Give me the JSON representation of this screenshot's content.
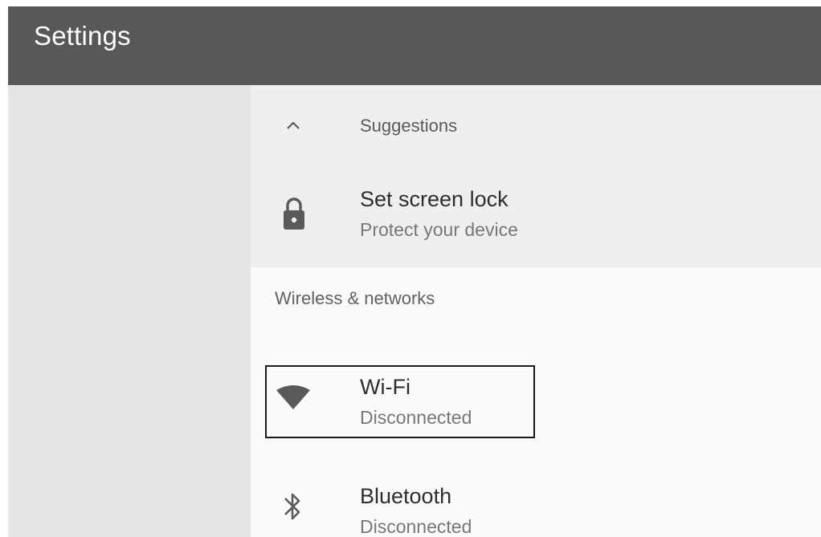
{
  "app_bar": {
    "title": "Settings"
  },
  "suggestions": {
    "label": "Suggestions",
    "toggle_icon": "chevron-up-icon",
    "items": [
      {
        "icon": "lock-icon",
        "title": "Set screen lock",
        "subtitle": "Protect your device"
      }
    ]
  },
  "wireless_networks": {
    "header": "Wireless & networks",
    "items": [
      {
        "icon": "wifi-icon",
        "title": "Wi-Fi",
        "subtitle": "Disconnected",
        "highlighted": true
      },
      {
        "icon": "bluetooth-icon",
        "title": "Bluetooth",
        "subtitle": "Disconnected"
      }
    ]
  },
  "colors": {
    "app_bar": "#585858",
    "left_pane": "#e5e5e5",
    "suggestions_bg": "#efefef",
    "content_bg": "#fafafa",
    "icon": "#5a5a5a",
    "highlight_border": "#1a1a1a"
  }
}
